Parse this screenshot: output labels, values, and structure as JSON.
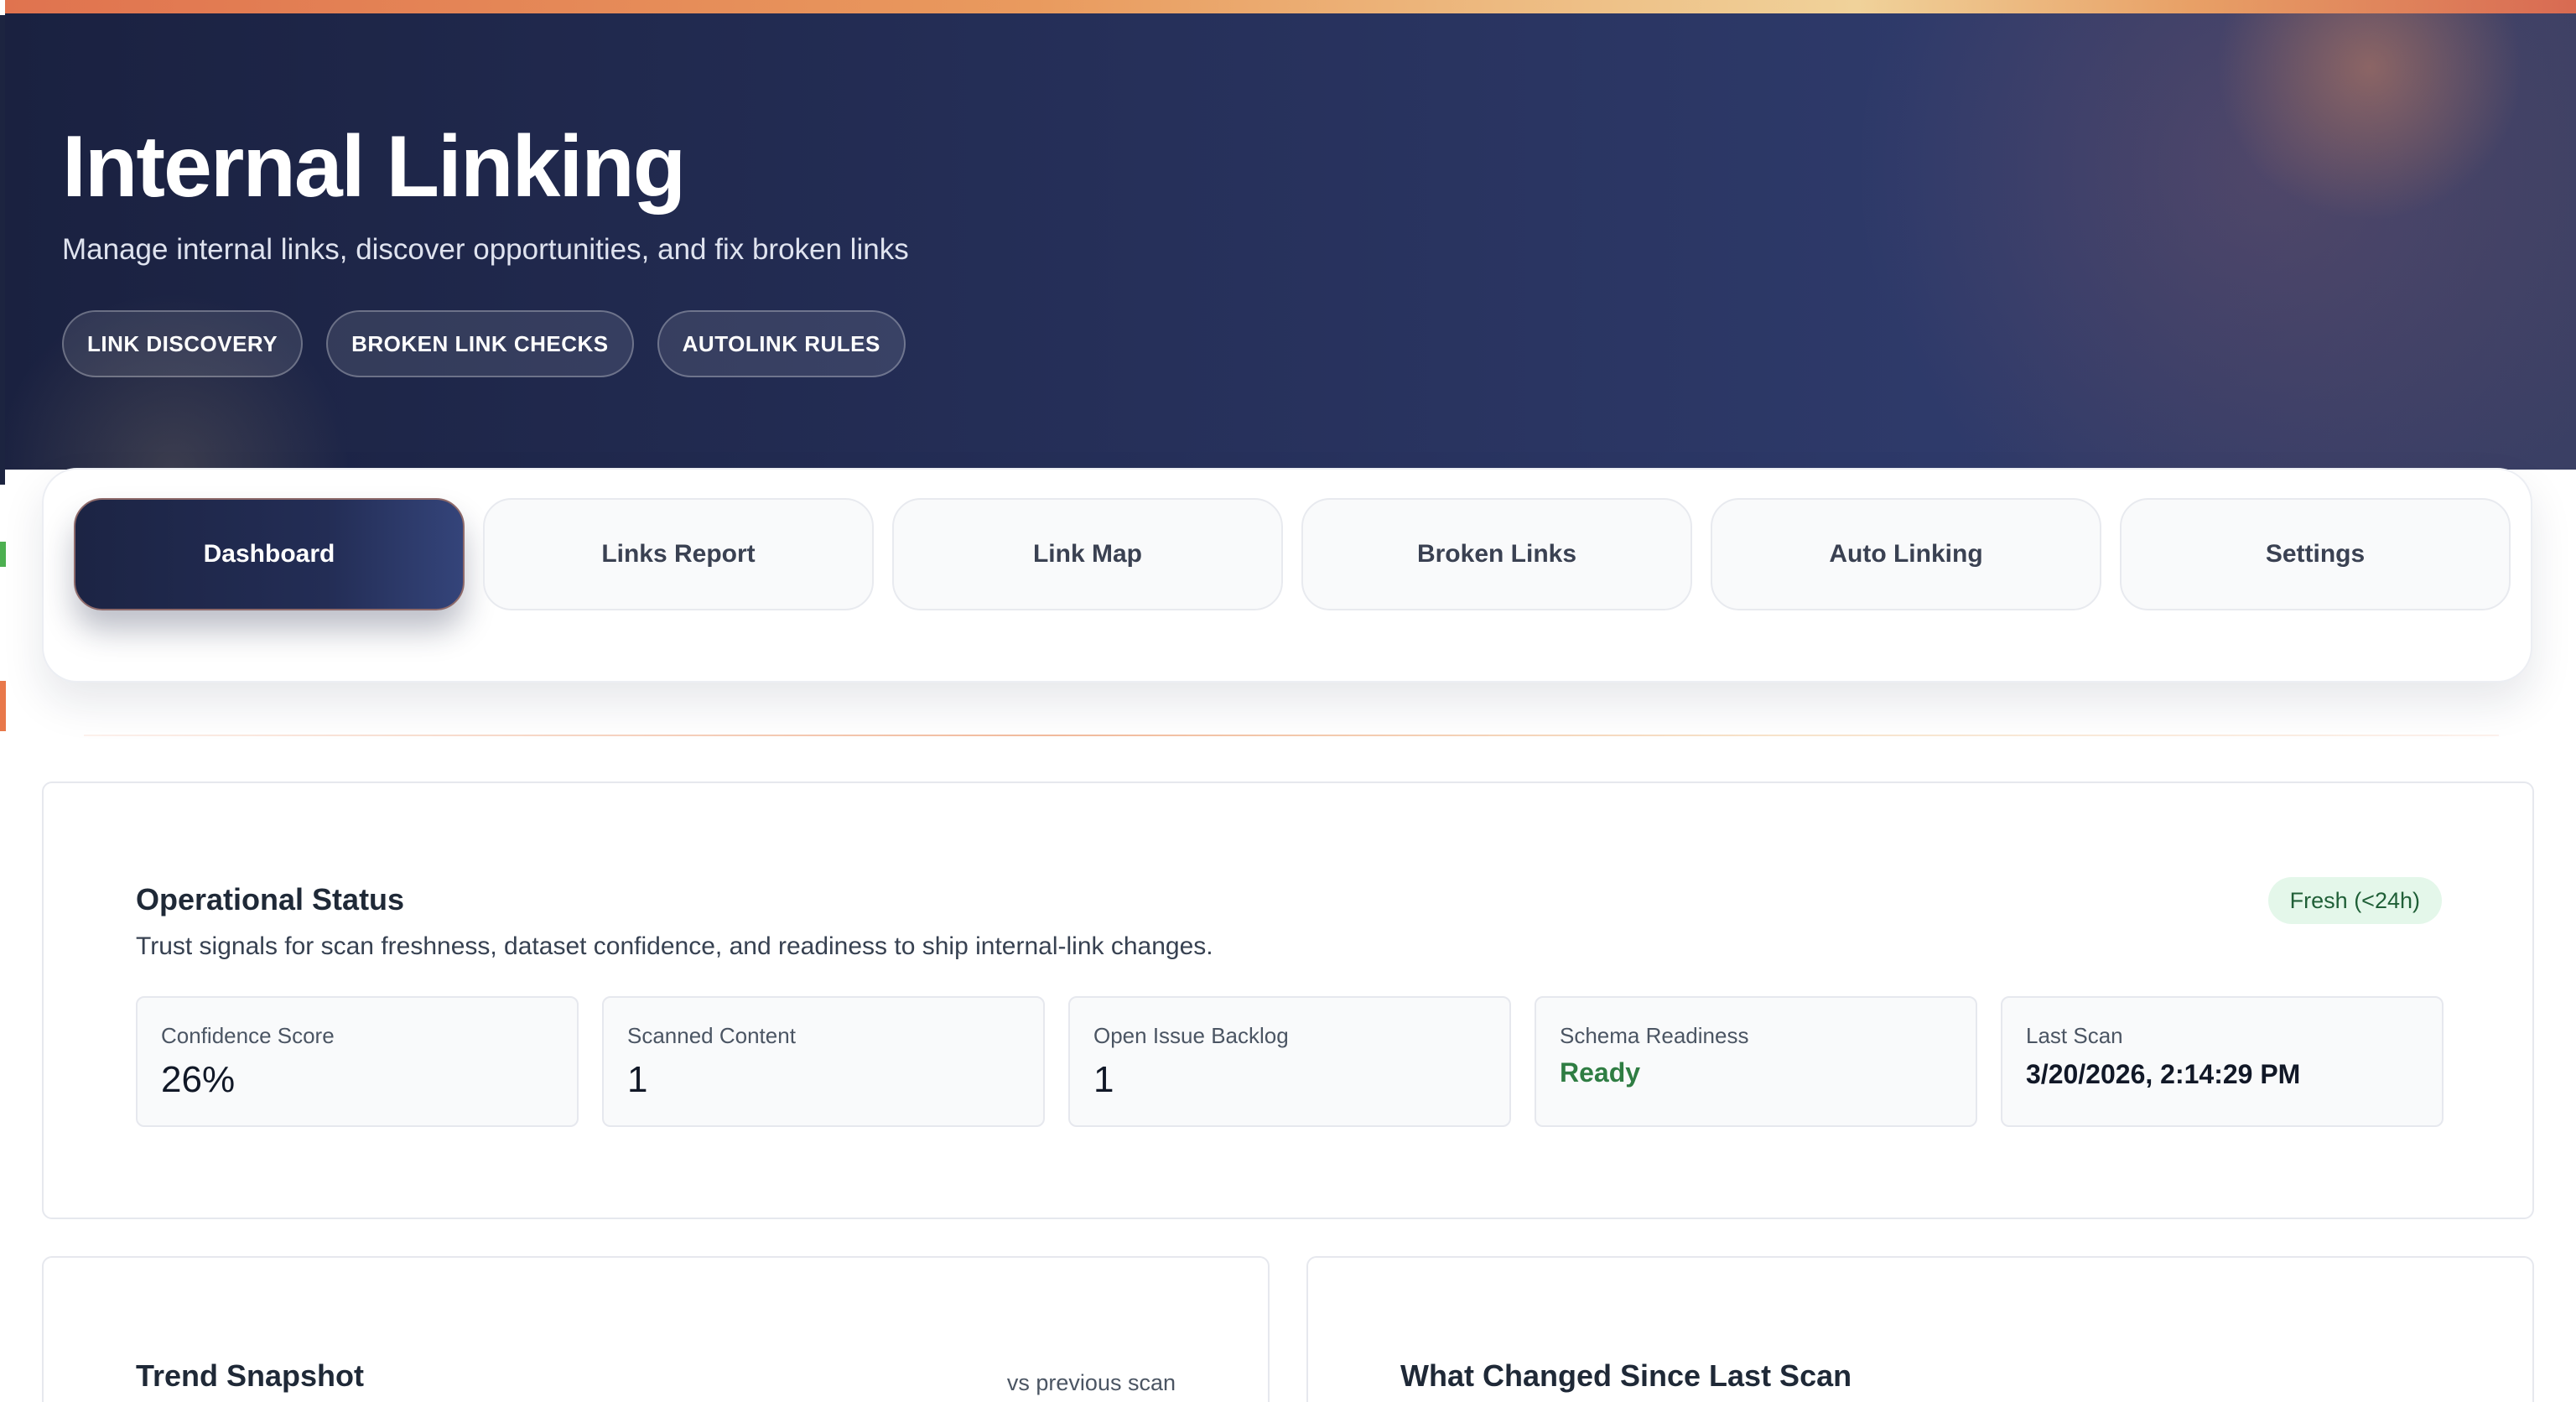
{
  "hero": {
    "title": "Internal Linking",
    "subtitle": "Manage internal links, discover opportunities, and fix broken links",
    "pills": [
      "LINK DISCOVERY",
      "BROKEN LINK CHECKS",
      "AUTOLINK RULES"
    ]
  },
  "tabs": [
    {
      "label": "Dashboard",
      "active": true
    },
    {
      "label": "Links Report",
      "active": false
    },
    {
      "label": "Link Map",
      "active": false
    },
    {
      "label": "Broken Links",
      "active": false
    },
    {
      "label": "Auto Linking",
      "active": false
    },
    {
      "label": "Settings",
      "active": false
    }
  ],
  "status": {
    "title": "Operational Status",
    "description": "Trust signals for scan freshness, dataset confidence, and readiness to ship internal-link changes.",
    "badge": "Fresh (<24h)",
    "metrics": [
      {
        "label": "Confidence Score",
        "value": "26%"
      },
      {
        "label": "Scanned Content",
        "value": "1"
      },
      {
        "label": "Open Issue Backlog",
        "value": "1"
      },
      {
        "label": "Schema Readiness",
        "value": "Ready"
      },
      {
        "label": "Last Scan",
        "value": "3/20/2026, 2:14:29 PM"
      }
    ]
  },
  "trend": {
    "title": "Trend Snapshot",
    "note": "vs previous scan"
  },
  "changes": {
    "title": "What Changed Since Last Scan"
  },
  "colors": {
    "hero_bg": "#26305a",
    "accent_orange": "#e8784a",
    "ready_green": "#2f7d43",
    "badge_bg": "#e4f7ea"
  }
}
